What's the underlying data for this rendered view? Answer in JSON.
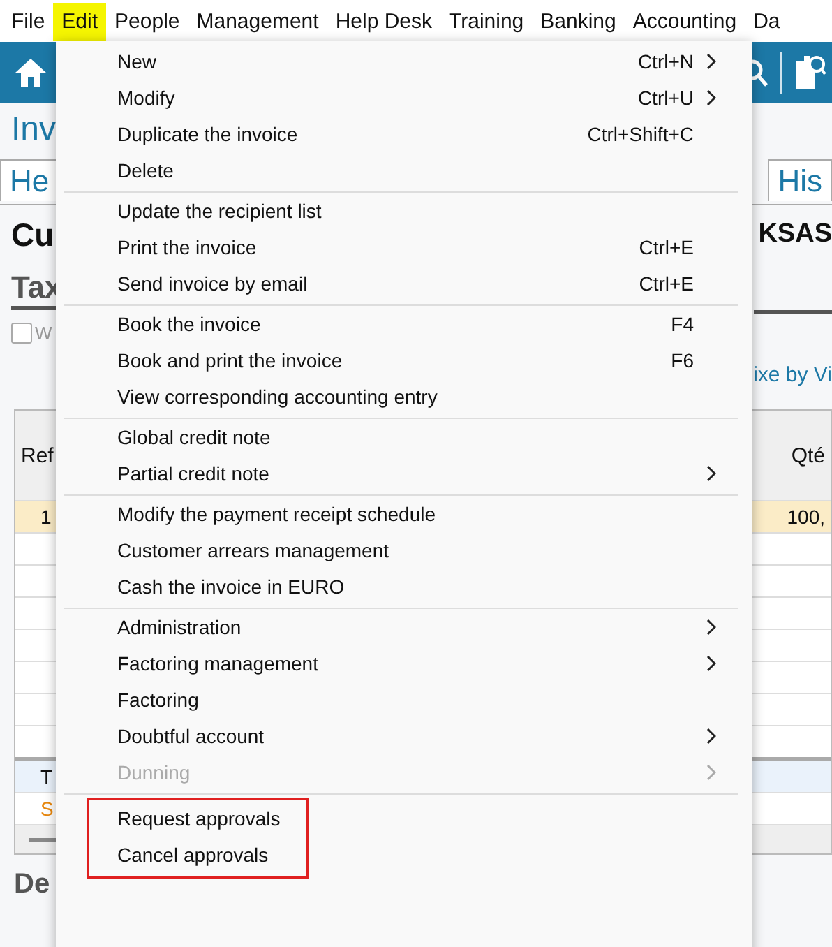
{
  "menubar": [
    {
      "label": "File",
      "selected": false
    },
    {
      "label": "Edit",
      "selected": true
    },
    {
      "label": "People",
      "selected": false
    },
    {
      "label": "Management",
      "selected": false
    },
    {
      "label": "Help Desk",
      "selected": false
    },
    {
      "label": "Training",
      "selected": false
    },
    {
      "label": "Banking",
      "selected": false
    },
    {
      "label": "Accounting",
      "selected": false
    },
    {
      "label": "Da",
      "selected": false
    }
  ],
  "page": {
    "title": "Inv",
    "tabs": [
      {
        "label": "He"
      },
      {
        "label": "His"
      }
    ],
    "heading_left": "Cu",
    "heading_right": "KSAS",
    "subtab": "Tax",
    "checkbox": {
      "label": "W",
      "checked": false
    },
    "link": "ixe by Vi",
    "table": {
      "column_1": "Ref",
      "column_2": "Qté",
      "rows": [
        {
          "cells": [
            "1",
            "100,"
          ]
        }
      ],
      "total_rows": [
        {
          "kind": "total",
          "text": "T"
        },
        {
          "kind": "warning",
          "text": "S"
        }
      ]
    },
    "bottom_tab": "De"
  },
  "menu": {
    "groups": [
      {
        "outlined": false,
        "items": [
          {
            "label": "New",
            "shortcut": "Ctrl+N",
            "submenu": true,
            "disabled": false
          },
          {
            "label": "Modify",
            "shortcut": "Ctrl+U",
            "submenu": true,
            "disabled": false
          },
          {
            "label": "Duplicate the invoice",
            "shortcut": "Ctrl+Shift+C",
            "submenu": false,
            "disabled": false
          },
          {
            "label": "Delete",
            "submenu": false,
            "disabled": false
          }
        ]
      },
      {
        "outlined": false,
        "items": [
          {
            "label": "Update the recipient list",
            "submenu": false,
            "disabled": false
          },
          {
            "label": "Print the invoice",
            "shortcut": "Ctrl+E",
            "submenu": false,
            "disabled": false
          },
          {
            "label": "Send invoice by email",
            "shortcut": "Ctrl+E",
            "submenu": false,
            "disabled": false
          }
        ]
      },
      {
        "outlined": false,
        "items": [
          {
            "label": "Book the invoice",
            "shortcut": "F4",
            "submenu": false,
            "disabled": false
          },
          {
            "label": "Book and print the invoice",
            "shortcut": "F6",
            "submenu": false,
            "disabled": false
          },
          {
            "label": "View corresponding accounting entry",
            "submenu": false,
            "disabled": false
          }
        ]
      },
      {
        "outlined": false,
        "items": [
          {
            "label": "Global credit note",
            "submenu": false,
            "disabled": false
          },
          {
            "label": "Partial credit note",
            "submenu": true,
            "disabled": false
          }
        ]
      },
      {
        "outlined": false,
        "items": [
          {
            "label": "Modify the payment receipt schedule",
            "submenu": false,
            "disabled": false
          },
          {
            "label": "Customer arrears management",
            "submenu": false,
            "disabled": false
          },
          {
            "label": "Cash the invoice in EURO",
            "submenu": false,
            "disabled": false
          }
        ]
      },
      {
        "outlined": false,
        "items": [
          {
            "label": "Administration",
            "submenu": true,
            "disabled": false
          },
          {
            "label": "Factoring management",
            "submenu": true,
            "disabled": false
          },
          {
            "label": "Factoring",
            "submenu": false,
            "disabled": false
          },
          {
            "label": "Doubtful account",
            "submenu": true,
            "disabled": false
          },
          {
            "label": "Dunning",
            "submenu": true,
            "disabled": true
          }
        ]
      },
      {
        "outlined": true,
        "items": [
          {
            "label": "Request approvals",
            "submenu": false,
            "disabled": false
          },
          {
            "label": "Cancel approvals",
            "submenu": false,
            "disabled": false
          }
        ]
      }
    ]
  }
}
